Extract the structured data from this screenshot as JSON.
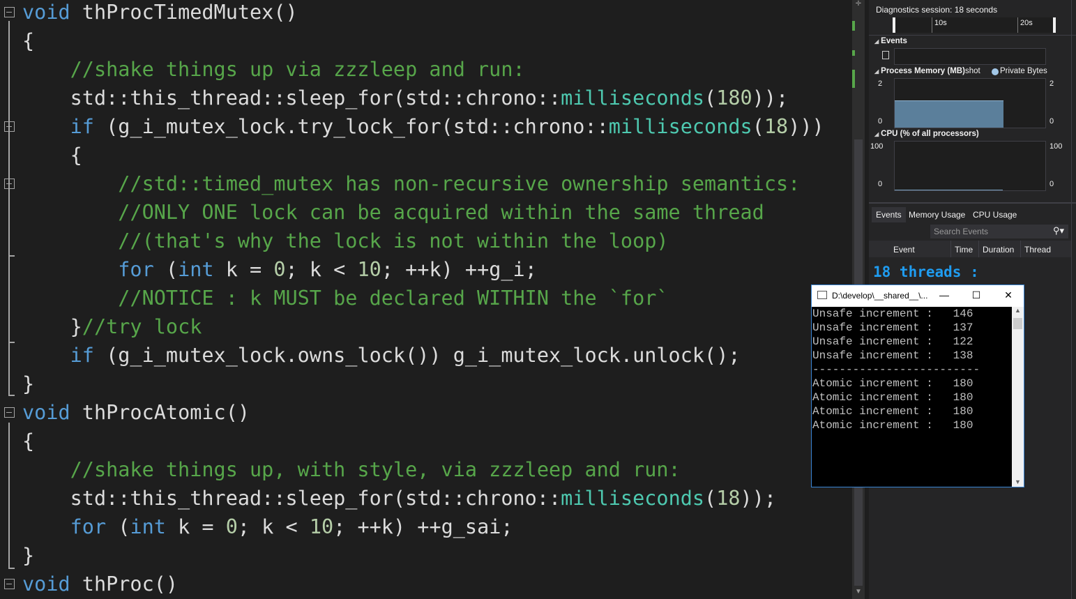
{
  "editor": {
    "lines": [
      {
        "fold": "box",
        "segs": [
          {
            "c": "kw",
            "t": "void"
          },
          {
            "c": "",
            "t": " thProcTimedMutex()"
          }
        ]
      },
      {
        "fold": "",
        "segs": [
          {
            "c": "",
            "t": "{"
          }
        ]
      },
      {
        "fold": "",
        "segs": [
          {
            "c": "cm",
            "t": "    //shake things up via zzzleep and run:"
          }
        ]
      },
      {
        "fold": "",
        "segs": [
          {
            "c": "",
            "t": "    std::this_thread::sleep_for(std::chrono::"
          },
          {
            "c": "ty",
            "t": "milliseconds"
          },
          {
            "c": "",
            "t": "("
          },
          {
            "c": "num",
            "t": "180"
          },
          {
            "c": "",
            "t": "));"
          }
        ]
      },
      {
        "fold": "box",
        "segs": [
          {
            "c": "kw",
            "t": "    if"
          },
          {
            "c": "",
            "t": " (g_i_mutex_lock.try_lock_for(std::chrono::"
          },
          {
            "c": "ty",
            "t": "milliseconds"
          },
          {
            "c": "",
            "t": "("
          },
          {
            "c": "num",
            "t": "18"
          },
          {
            "c": "",
            "t": ")))"
          }
        ]
      },
      {
        "fold": "",
        "segs": [
          {
            "c": "",
            "t": "    {"
          }
        ]
      },
      {
        "fold": "box",
        "segs": [
          {
            "c": "cm",
            "t": "        //std::timed_mutex has non-recursive ownership semantics:"
          }
        ]
      },
      {
        "fold": "",
        "segs": [
          {
            "c": "cm",
            "t": "        //ONLY ONE lock can be acquired within the same thread"
          }
        ]
      },
      {
        "fold": "",
        "segs": [
          {
            "c": "cm",
            "t": "        //(that's why the lock is not within the loop)"
          }
        ]
      },
      {
        "fold": "",
        "segs": [
          {
            "c": "kw",
            "t": "        for"
          },
          {
            "c": "",
            "t": " ("
          },
          {
            "c": "kw",
            "t": "int"
          },
          {
            "c": "",
            "t": " k = "
          },
          {
            "c": "num",
            "t": "0"
          },
          {
            "c": "",
            "t": "; k < "
          },
          {
            "c": "num",
            "t": "10"
          },
          {
            "c": "",
            "t": "; ++k) ++g_i;"
          }
        ]
      },
      {
        "fold": "",
        "segs": [
          {
            "c": "cm",
            "t": "        //NOTICE : k MUST be declared WITHIN the `for`"
          }
        ]
      },
      {
        "fold": "",
        "segs": [
          {
            "c": "",
            "t": "    }"
          },
          {
            "c": "cm",
            "t": "//try lock"
          }
        ]
      },
      {
        "fold": "",
        "segs": [
          {
            "c": "kw",
            "t": "    if"
          },
          {
            "c": "",
            "t": " (g_i_mutex_lock.owns_lock()) g_i_mutex_lock.unlock();"
          }
        ]
      },
      {
        "fold": "",
        "segs": [
          {
            "c": "",
            "t": "}"
          }
        ]
      },
      {
        "fold": "box",
        "segs": [
          {
            "c": "kw",
            "t": "void"
          },
          {
            "c": "",
            "t": " thProcAtomic()"
          }
        ]
      },
      {
        "fold": "",
        "segs": [
          {
            "c": "",
            "t": "{"
          }
        ]
      },
      {
        "fold": "",
        "segs": [
          {
            "c": "cm",
            "t": "    //shake things up, with style, via zzzleep and run:"
          }
        ]
      },
      {
        "fold": "",
        "segs": [
          {
            "c": "",
            "t": "    std::this_thread::sleep_for(std::chrono::"
          },
          {
            "c": "ty",
            "t": "milliseconds"
          },
          {
            "c": "",
            "t": "("
          },
          {
            "c": "num",
            "t": "18"
          },
          {
            "c": "",
            "t": "));"
          }
        ]
      },
      {
        "fold": "",
        "segs": [
          {
            "c": "kw",
            "t": "    for"
          },
          {
            "c": "",
            "t": " ("
          },
          {
            "c": "kw",
            "t": "int"
          },
          {
            "c": "",
            "t": " k = "
          },
          {
            "c": "num",
            "t": "0"
          },
          {
            "c": "",
            "t": "; k < "
          },
          {
            "c": "num",
            "t": "10"
          },
          {
            "c": "",
            "t": "; ++k) ++g_sai;"
          }
        ]
      },
      {
        "fold": "",
        "segs": [
          {
            "c": "",
            "t": "}"
          }
        ]
      },
      {
        "fold": "box",
        "segs": [
          {
            "c": "kw",
            "t": "void"
          },
          {
            "c": "",
            "t": " thProc()"
          }
        ]
      }
    ]
  },
  "diagnostics": {
    "title": "Diagnostics session: 18 seconds",
    "ruler": {
      "t10": "10s",
      "t20": "20s"
    },
    "events_header": "Events",
    "memory_header": "Process Memory (MB)",
    "memory_legend_snapshot": "shot",
    "memory_legend_private": "Private Bytes",
    "memory_y_max": "2",
    "memory_y_min": "0",
    "memory_fill_fraction": 0.72,
    "cpu_header": "CPU (% of all processors)",
    "cpu_y_max": "100",
    "cpu_y_min": "0",
    "tabs": [
      "Events",
      "Memory Usage",
      "CPU Usage"
    ],
    "search_placeholder": "Search Events",
    "columns": [
      "Event",
      "Time",
      "Duration",
      "Thread"
    ],
    "output_text": "18 threads :"
  },
  "console": {
    "title": "D:\\develop\\__shared__\\...",
    "lines": [
      "Unsafe increment :   146",
      "Unsafe increment :   137",
      "Unsafe increment :   122",
      "Unsafe increment :   138",
      "-------------------------",
      "Atomic increment :   180",
      "Atomic increment :   180",
      "Atomic increment :   180",
      "Atomic increment :   180"
    ]
  },
  "colors": {
    "keyword": "#569cd6",
    "comment": "#57a64a",
    "type": "#4ec9b0",
    "number": "#b5cea8",
    "memory_fill": "#5b7f9b",
    "output_text": "#1f9cf0"
  }
}
